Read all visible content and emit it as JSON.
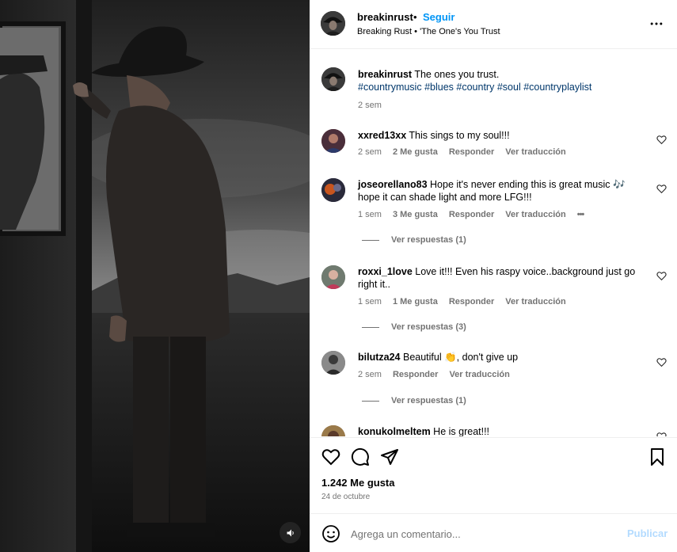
{
  "post": {
    "username": "breakinrust",
    "dot": "•",
    "follow_label": "Seguir",
    "subtitle_artist": "Breaking Rust",
    "subtitle_sep": "•",
    "subtitle_song": "'The One's You Trust"
  },
  "caption": {
    "username": "breakinrust",
    "text": "The ones you trust.",
    "hashtags": [
      "#countrymusic",
      "#blues",
      "#country",
      "#soul",
      "#countryplaylist"
    ],
    "time": "2 sem"
  },
  "comments": [
    {
      "username": "xxred13xx",
      "text": "This sings to my soul!!!",
      "time": "2 sem",
      "likes": "2 Me gusta",
      "reply": "Responder",
      "translate": "Ver traducción"
    },
    {
      "username": "joseorellano83",
      "text": "Hope it's never ending this is great music 🎶 hope it can shade light and more LFG!!!",
      "time": "1 sem",
      "likes": "3 Me gusta",
      "reply": "Responder",
      "translate": "Ver traducción",
      "more": "•••",
      "replies": "Ver respuestas (1)"
    },
    {
      "username": "roxxi_1love",
      "text": "Love it!!! Even his raspy voice..background just go right it..",
      "time": "1 sem",
      "likes": "1 Me gusta",
      "reply": "Responder",
      "translate": "Ver traducción",
      "replies": "Ver respuestas (3)"
    },
    {
      "username": "bilutza24",
      "text": "Beautiful 👏, don't give up",
      "time": "2 sem",
      "reply": "Responder",
      "translate": "Ver traducción",
      "replies": "Ver respuestas (1)"
    },
    {
      "username": "konukolmeltem",
      "text": "He is great!!!"
    }
  ],
  "footer": {
    "likes": "1.242 Me gusta",
    "date": "24 de octubre",
    "input_placeholder": "Agrega un comentario...",
    "publish_label": "Publicar"
  },
  "icons": {
    "more": "more-horizontal-icon",
    "heart": "heart-outline-icon",
    "comment": "comment-bubble-icon",
    "share": "paper-plane-icon",
    "save": "bookmark-icon",
    "emoji": "smiley-icon",
    "sound": "speaker-icon"
  },
  "colors": {
    "accent": "#0095f6",
    "hashtag": "#00376b",
    "secondary_text": "#737373",
    "publish_disabled": "#b3dbff"
  }
}
